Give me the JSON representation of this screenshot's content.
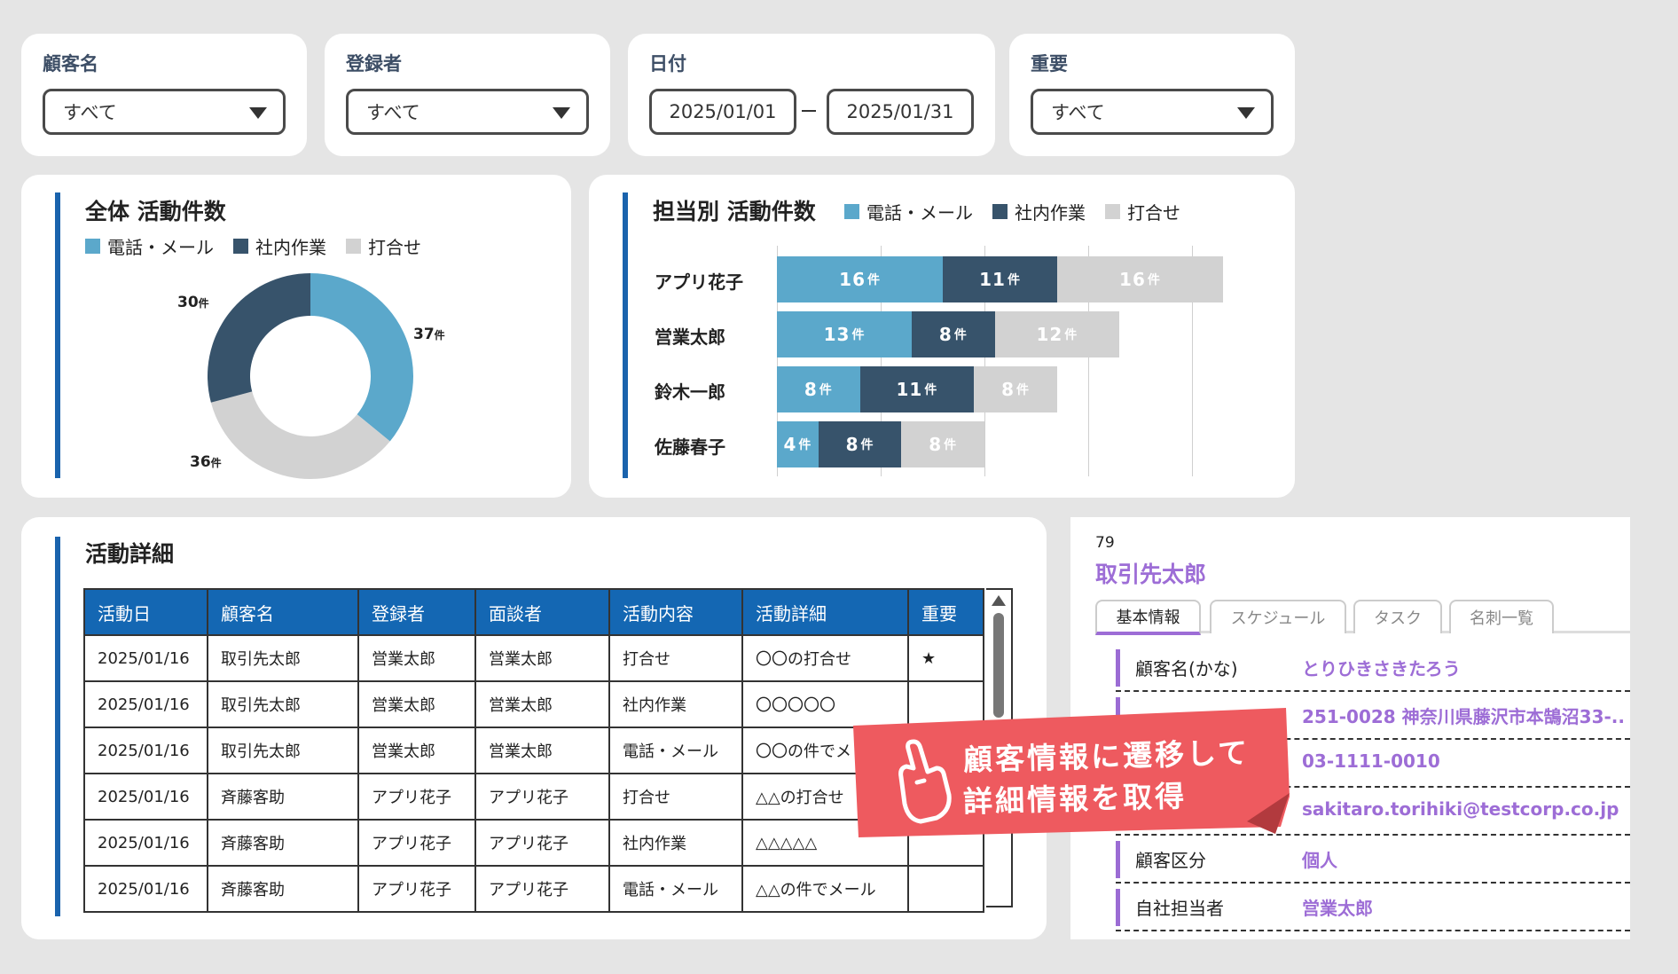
{
  "filters": {
    "customer": {
      "label": "顧客名",
      "value": "すべて"
    },
    "registrant": {
      "label": "登録者",
      "value": "すべて"
    },
    "date": {
      "label": "日付",
      "from": "2025/01/01",
      "to": "2025/01/31"
    },
    "important": {
      "label": "重要",
      "value": "すべて"
    }
  },
  "overall": {
    "title": "全体 活動件数",
    "legend": [
      "電話・メール",
      "社内作業",
      "打合せ"
    ],
    "labels": [
      "37",
      "36",
      "30"
    ],
    "unit": "件"
  },
  "by_person": {
    "title": "担当別 活動件数",
    "legend": [
      "電話・メール",
      "社内作業",
      "打合せ"
    ],
    "persons": [
      "アプリ花子",
      "営業太郎",
      "鈴木一郎",
      "佐藤春子"
    ],
    "unit": "件"
  },
  "colors": {
    "phone_mail": "#5ba8cb",
    "internal": "#37536b",
    "meeting": "#d2d2d2",
    "accent": "#1a63ad",
    "header": "#1467b3",
    "purple": "#9d6dd6",
    "callout": "#ee5a5f"
  },
  "chart_data": [
    {
      "type": "pie",
      "title": "全体 活動件数",
      "categories": [
        "電話・メール",
        "社内作業",
        "打合せ"
      ],
      "values": [
        37,
        30,
        36
      ],
      "donut": true
    },
    {
      "type": "bar",
      "orientation": "horizontal",
      "stacked": true,
      "title": "担当別 活動件数",
      "categories": [
        "アプリ花子",
        "営業太郎",
        "鈴木一郎",
        "佐藤春子"
      ],
      "series": [
        {
          "name": "電話・メール",
          "values": [
            16,
            13,
            8,
            4
          ]
        },
        {
          "name": "社内作業",
          "values": [
            11,
            8,
            11,
            8
          ]
        },
        {
          "name": "打合せ",
          "values": [
            16,
            12,
            8,
            8
          ]
        }
      ],
      "legend": "top"
    }
  ],
  "detail": {
    "title": "活動詳細",
    "columns": [
      "活動日",
      "顧客名",
      "登録者",
      "面談者",
      "活動内容",
      "活動詳細",
      "重要"
    ],
    "rows": [
      [
        "2025/01/16",
        "取引先太郎",
        "営業太郎",
        "営業太郎",
        "打合せ",
        "〇〇の打合せ",
        "★"
      ],
      [
        "2025/01/16",
        "取引先太郎",
        "営業太郎",
        "営業太郎",
        "社内作業",
        "〇〇〇〇〇",
        ""
      ],
      [
        "2025/01/16",
        "取引先太郎",
        "営業太郎",
        "営業太郎",
        "電話・メール",
        "〇〇の件でメ",
        ""
      ],
      [
        "2025/01/16",
        "斉藤客助",
        "アプリ花子",
        "アプリ花子",
        "打合せ",
        "△△の打合せ",
        ""
      ],
      [
        "2025/01/16",
        "斉藤客助",
        "アプリ花子",
        "アプリ花子",
        "社内作業",
        "△△△△△",
        ""
      ],
      [
        "2025/01/16",
        "斉藤客助",
        "アプリ花子",
        "アプリ花子",
        "電話・メール",
        "△△の件でメール",
        ""
      ]
    ]
  },
  "profile": {
    "id": "79",
    "name": "取引先太郎",
    "tabs": [
      "基本情報",
      "スケジュール",
      "タスク",
      "名刺一覧"
    ],
    "fields": [
      {
        "key": "顧客名(かな)",
        "value": "とりひきさきたろう"
      },
      {
        "key": "",
        "value": "251-0028 神奈川県藤沢市本鵠沼33-.."
      },
      {
        "key": "",
        "value": "03-1111-0010"
      },
      {
        "key": "",
        "value": "sakitaro.torihiki@testcorp.co.jp"
      },
      {
        "key": "顧客区分",
        "value": "個人"
      },
      {
        "key": "自社担当者",
        "value": "営業太郎"
      }
    ]
  },
  "callout": {
    "line1": "顧客情報に遷移して",
    "line2": "詳細情報を取得"
  }
}
